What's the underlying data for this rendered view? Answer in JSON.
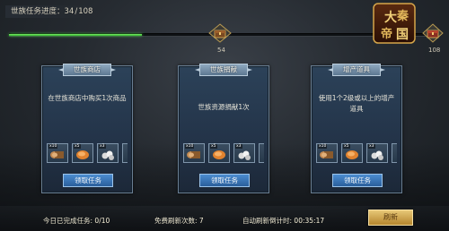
{
  "header": {
    "progress_label": "世族任务进度：",
    "progress_current": "34",
    "progress_sep": "/",
    "progress_total": "108",
    "progress_fraction": 0.315,
    "milestone_value": "54",
    "end_value": "108",
    "logo_text": "大秦帝国",
    "logo_icon": "game-logo",
    "chest_icon": "treasure-chest-icon"
  },
  "cards": [
    {
      "title": "世族商店",
      "description": "在世族商店中购买1次商品",
      "rewards": [
        {
          "qty": "x10"
        },
        {
          "qty": "x5"
        },
        {
          "qty": "x3"
        }
      ],
      "claim_label": "领取任务"
    },
    {
      "title": "世族捐献",
      "description": "世族资源捐献1次",
      "rewards": [
        {
          "qty": "x10"
        },
        {
          "qty": "x5"
        },
        {
          "qty": "x3"
        }
      ],
      "claim_label": "领取任务"
    },
    {
      "title": "增产道具",
      "description": "使用1个2级或以上的增产道具",
      "rewards": [
        {
          "qty": "x10"
        },
        {
          "qty": "x5"
        },
        {
          "qty": "x3"
        }
      ],
      "claim_label": "领取任务"
    }
  ],
  "footer": {
    "completed_label": "今日已完成任务:",
    "completed_value": "0/10",
    "free_refresh_label": "免费刷新次数:",
    "free_refresh_value": "7",
    "auto_refresh_label": "自动刷新倒计时:",
    "auto_refresh_value": "00:35:17",
    "refresh_button": "刷新"
  },
  "colors": {
    "progress_fill": "#3fcf3a",
    "card_bg": "#2a3f56",
    "claim_button": "#3a78bd",
    "refresh_button": "#d1a84f"
  }
}
